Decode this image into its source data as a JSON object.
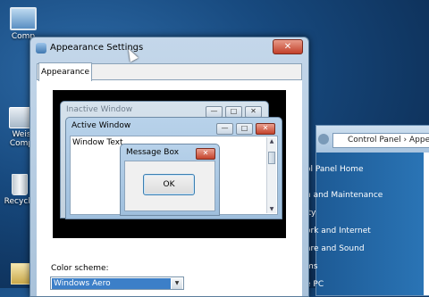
{
  "desktop": {
    "icons": [
      {
        "label": "Comp",
        "icon": "computer-icon"
      },
      {
        "label": "Weis",
        "label2": "Comp",
        "icon": "network-computer-icon"
      },
      {
        "label": "Recycle",
        "icon": "recycle-bin-icon"
      },
      {
        "label": "",
        "icon": "folder-icon"
      }
    ]
  },
  "control_panel": {
    "address": "Control Panel › Appea",
    "sidebar": [
      "ol Panel Home",
      "n and Maintenance",
      "ity",
      "ork and Internet",
      "are and Sound",
      "ms",
      "e PC"
    ]
  },
  "appearance_window": {
    "title": "Appearance Settings",
    "close_symbol": "✕",
    "tab_label": "Appearance",
    "preview": {
      "inactive_title": "Inactive Window",
      "active_title": "Active Window",
      "window_text": "Window Text",
      "message_box_title": "Message Box",
      "ok_label": "OK",
      "min_symbol": "—",
      "max_symbol": "□",
      "close_symbol": "✕"
    },
    "color_scheme_label": "Color scheme:",
    "color_scheme_value": "Windows Aero"
  }
}
